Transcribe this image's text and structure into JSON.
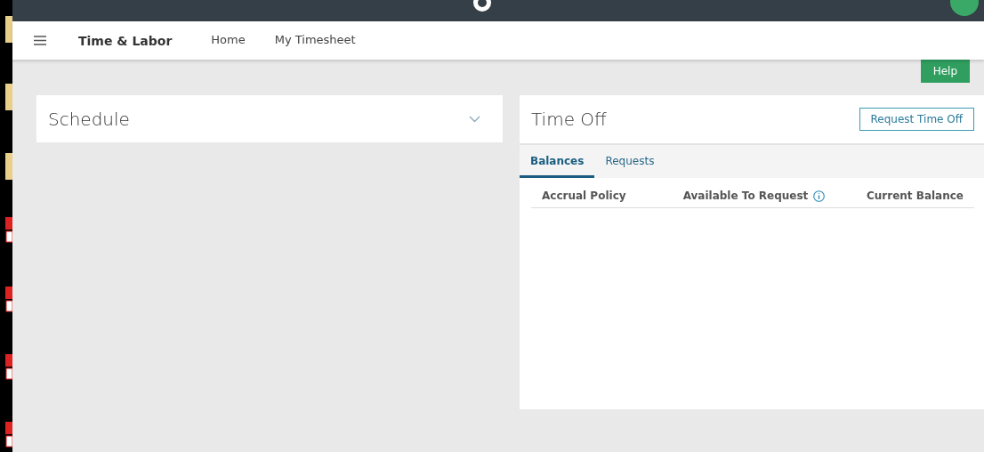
{
  "app_header": {
    "title": "Time & Labor",
    "nav": [
      {
        "label": "Home",
        "selected": false
      },
      {
        "label": "My Timesheet",
        "selected": false
      }
    ]
  },
  "help_button": "Help",
  "schedule": {
    "title": "Schedule",
    "expanded": false
  },
  "time_off": {
    "title": "Time Off",
    "action": "Request Time Off",
    "tabs": [
      {
        "label": "Balances",
        "selected": true
      },
      {
        "label": "Requests",
        "selected": false
      }
    ],
    "columns": [
      "Accrual Policy",
      "Available To Request",
      "Current Balance"
    ]
  }
}
